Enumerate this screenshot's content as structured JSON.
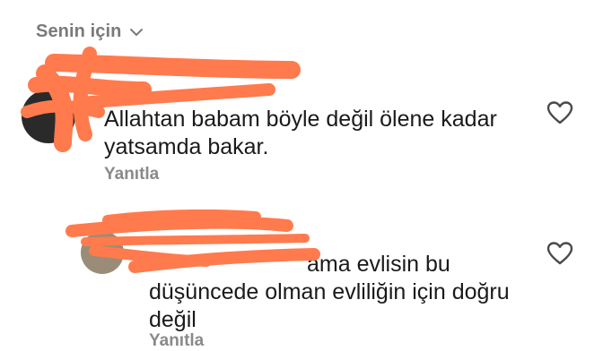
{
  "filter": {
    "label": "Senin için",
    "icon": "chevron-down-icon"
  },
  "comments": [
    {
      "text": "Allahtan babam böyle değil ölene kadar yatsamda bakar.",
      "reply_label": "Yanıtla",
      "like_icon": "heart-outline-icon"
    },
    {
      "text_visible": "ama evlisin bu düşüncede olman evliliğin için doğru değil",
      "reply_label": "Yanıtla",
      "like_icon": "heart-outline-icon"
    }
  ],
  "colors": {
    "redaction": "#ff7a4d",
    "secondary_text": "#7a7a7a",
    "primary_text": "#1a1a1a"
  }
}
